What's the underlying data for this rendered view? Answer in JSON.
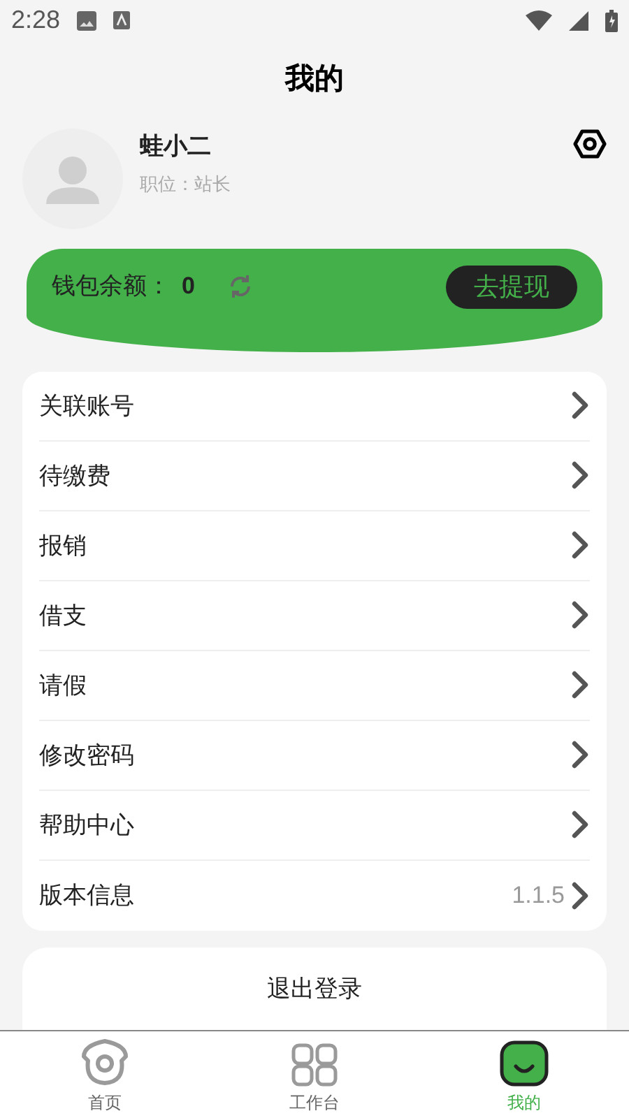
{
  "status_bar": {
    "time": "2:28"
  },
  "header": {
    "title": "我的"
  },
  "profile": {
    "name": "蛙小二",
    "position": "职位：站长"
  },
  "wallet": {
    "label": "钱包余额：",
    "balance": "0",
    "button": "去提现"
  },
  "menu": [
    {
      "label": "关联账号"
    },
    {
      "label": "待缴费"
    },
    {
      "label": "报销"
    },
    {
      "label": "借支"
    },
    {
      "label": "请假"
    },
    {
      "label": "修改密码"
    },
    {
      "label": "帮助中心"
    },
    {
      "label": "版本信息",
      "value": "1.1.5"
    }
  ],
  "logout": "退出登录",
  "tabs": [
    {
      "label": "首页",
      "kind": "home",
      "selected": false
    },
    {
      "label": "工作台",
      "kind": "grid",
      "selected": false
    },
    {
      "label": "我的",
      "kind": "me",
      "selected": true
    }
  ]
}
